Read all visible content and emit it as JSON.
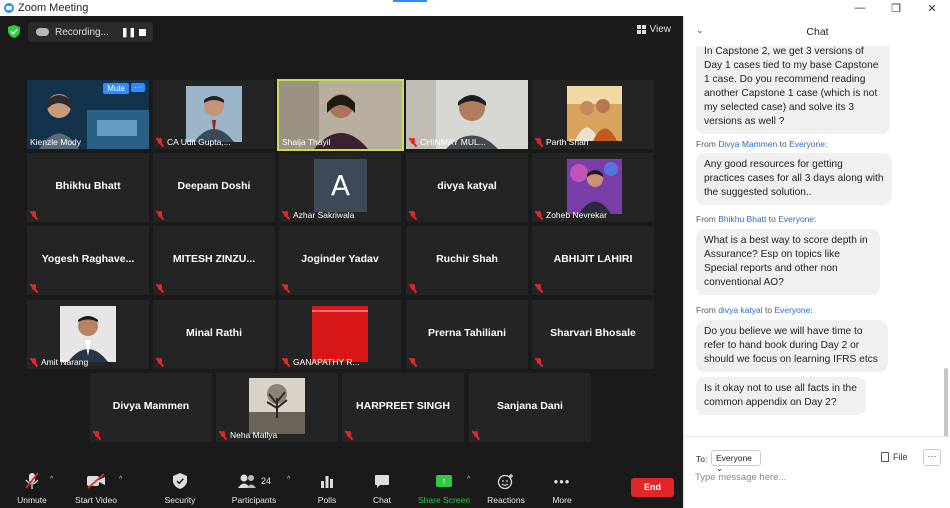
{
  "window": {
    "title": "Zoom Meeting",
    "minimize": "—",
    "restore": "❐",
    "close": "✕"
  },
  "recording": {
    "label": "Recording...",
    "pause_icon": "pause-icon",
    "stop_icon": "stop-icon"
  },
  "view_label": "View",
  "participants": [
    {
      "name": "Kienzle Mody",
      "video": true,
      "mute_tag": "Mute",
      "more_tag": "···"
    },
    {
      "name": "CA Udit Gupta,...",
      "video": true
    },
    {
      "name": "Shaija Thayil",
      "video": true,
      "active": true
    },
    {
      "name": "CHINMAY MUL...",
      "video": true
    },
    {
      "name": "Parth Shah",
      "video": true
    },
    {
      "name": "Bhikhu Bhatt"
    },
    {
      "name": "Deepam Doshi"
    },
    {
      "name": "Azhar Sakriwala",
      "initial": "A"
    },
    {
      "name": "divya katyal"
    },
    {
      "name": "Zoheb Nevrekar",
      "video": true
    },
    {
      "name": "Yogesh  Raghave..."
    },
    {
      "name": "MITESH  ZINZU..."
    },
    {
      "name": "Joginder Yadav"
    },
    {
      "name": "Ruchir Shah"
    },
    {
      "name": "ABHIJIT LAHIRI"
    },
    {
      "name": "Amit Narang",
      "video": true
    },
    {
      "name": "Minal Rathi"
    },
    {
      "name": "GANAPATHY R...",
      "video": true
    },
    {
      "name": "Prerna Tahiliani"
    },
    {
      "name": "Sharvari Bhosale"
    },
    {
      "name": "Divya Mammen"
    },
    {
      "name": "Neha Mallya",
      "video": true
    },
    {
      "name": "HARPREET SINGH"
    },
    {
      "name": "Sanjana Dani"
    }
  ],
  "toolbar": {
    "unmute": "Unmute",
    "start_video": "Start Video",
    "security": "Security",
    "participants": "Participants",
    "participants_count": "24",
    "polls": "Polls",
    "chat": "Chat",
    "share_screen": "Share Screen",
    "reactions": "Reactions",
    "more": "More",
    "end": "End"
  },
  "chat": {
    "title": "Chat",
    "messages": [
      {
        "text": "In Capstone 2, we get 3 versions of Day 1 cases tied to my base Capstone 1 case. Do you recommend reading another Capstone 1 case (which is not my selected case) and solve its 3 versions as well ?"
      },
      {
        "from_prefix": "From ",
        "from": "Divya Mammen",
        "to_prefix": " to ",
        "to": "Everyone",
        "suffix": ":",
        "text": "Any good resources for getting practices cases for all 3 days along with the suggested solution.."
      },
      {
        "from_prefix": "From ",
        "from": "Bhikhu Bhatt",
        "to_prefix": " to ",
        "to": "Everyone",
        "suffix": ":",
        "text": "What is a best way to score depth in Assurance? Esp on topics like Special reports and other non conventional AO?"
      },
      {
        "from_prefix": "From ",
        "from": "divya katyal",
        "to_prefix": " to ",
        "to": "Everyone",
        "suffix": ":",
        "text": "Do you believe we will have time to refer to hand book during Day 2 or should we focus on learning IFRS etcs"
      },
      {
        "text": "Is it okay not to use all facts in the common appendix on Day 2?"
      }
    ],
    "to_label": "To:",
    "to_value": "Everyone",
    "file_label": "File",
    "more": "···",
    "input_placeholder": "Type message here..."
  }
}
